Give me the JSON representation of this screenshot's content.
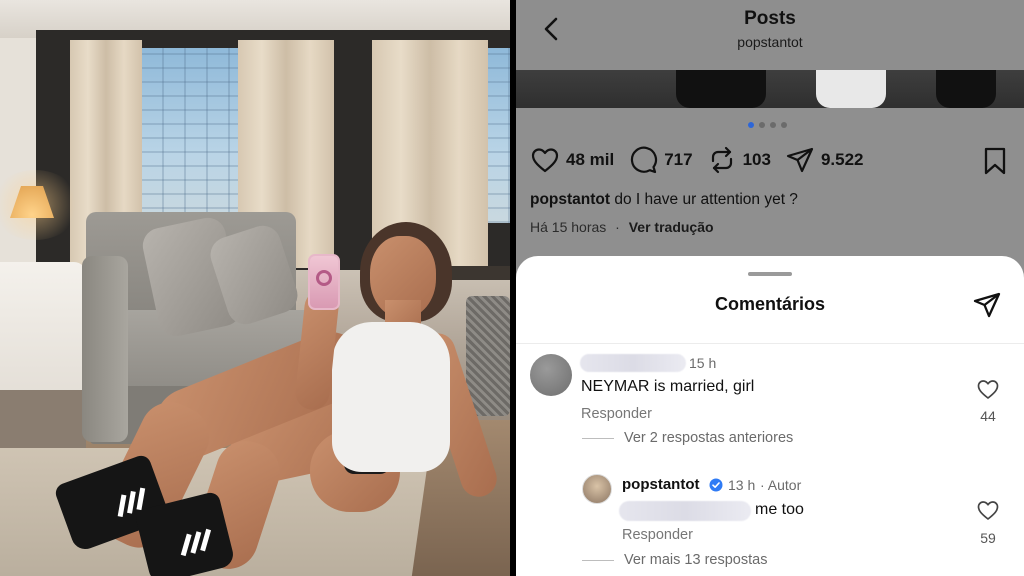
{
  "header": {
    "title": "Posts",
    "subtitle": "popstantot"
  },
  "post": {
    "carousel_dots": 4,
    "carousel_active": 0,
    "likes": "48 mil",
    "comments": "717",
    "reposts": "103",
    "shares": "9.522",
    "caption_user": "popstantot",
    "caption_text": " do I have ur attention yet ?",
    "time_ago": "Há 15 horas",
    "separator": "·",
    "translate_label": "Ver tradução"
  },
  "comments_sheet": {
    "title": "Comentários",
    "comments": [
      {
        "time": "15 h",
        "text": "NEYMAR is married, girl",
        "reply_label": "Responder",
        "likes": "44",
        "view_replies": "Ver 2 respostas anteriores"
      },
      {
        "username": "popstantot",
        "time": "13 h",
        "author_tag": "· Autor",
        "text_suffix": "me too",
        "reply_label": "Responder",
        "likes": "59",
        "view_replies": "Ver mais 13 respostas"
      }
    ]
  },
  "colors": {
    "overlay_gray": "#8f8f8f",
    "sheet_bg": "#ffffff",
    "verified_blue": "#2f7bf5",
    "active_dot": "#2d66d8"
  },
  "icons": {
    "back": "chevron-left-icon",
    "like": "heart-icon",
    "comment": "comment-bubble-icon",
    "repost": "repost-icon",
    "share": "paper-plane-icon",
    "bookmark": "bookmark-icon",
    "verified": "verified-badge-icon"
  }
}
